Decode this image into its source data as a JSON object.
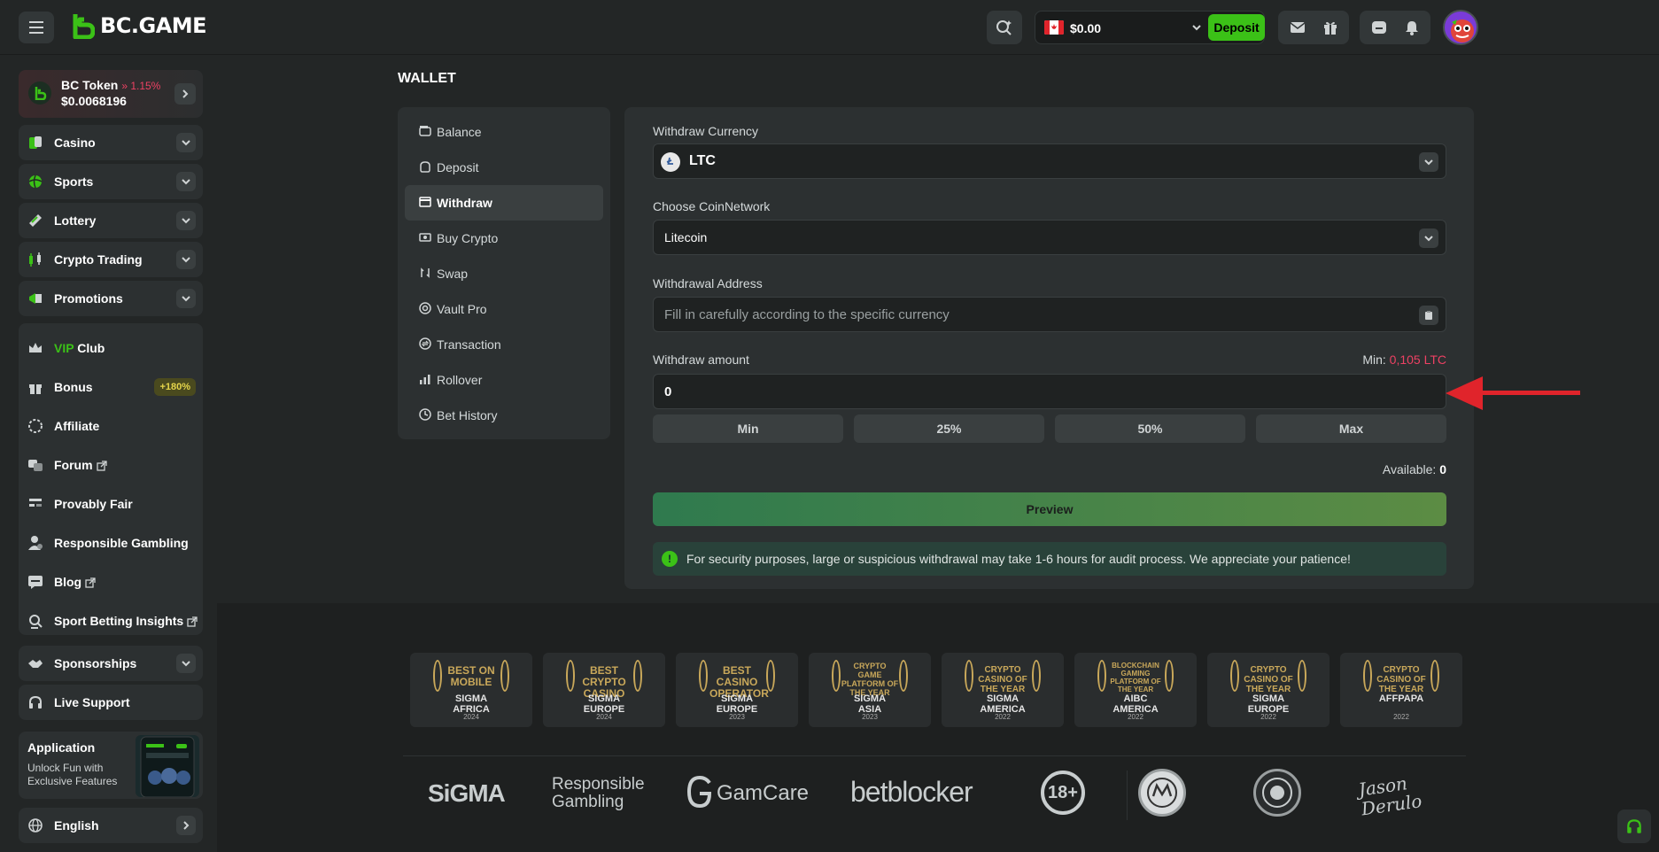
{
  "header": {
    "logo_text": "BC.GAME",
    "balance": "$0.00",
    "deposit_label": "Deposit"
  },
  "sidebar": {
    "token": {
      "name": "BC Token",
      "change": "1.15%",
      "price": "$0.0068196"
    },
    "sections": [
      {
        "label": "Casino",
        "icon": "cards-icon"
      },
      {
        "label": "Sports",
        "icon": "ball-icon"
      },
      {
        "label": "Lottery",
        "icon": "ticket-icon"
      },
      {
        "label": "Crypto Trading",
        "icon": "candles-icon"
      },
      {
        "label": "Promotions",
        "icon": "megaphone-icon"
      }
    ],
    "group_items": {
      "vip_prefix": "VIP",
      "vip_suffix": "Club",
      "bonus": "Bonus",
      "bonus_badge": "+180%",
      "affiliate": "Affiliate",
      "forum": "Forum",
      "provably_fair": "Provably Fair",
      "responsible_gambling": "Responsible Gambling",
      "blog": "Blog",
      "sport_betting_insights": "Sport Betting Insights"
    },
    "sponsorships": "Sponsorships",
    "live_support": "Live Support",
    "application": {
      "title": "Application",
      "subtitle": "Unlock Fun with Exclusive Features"
    },
    "language": "English"
  },
  "wallet": {
    "title": "WALLET",
    "menu": [
      {
        "label": "Balance",
        "icon": "wallet-icon"
      },
      {
        "label": "Deposit",
        "icon": "deposit-icon"
      },
      {
        "label": "Withdraw",
        "icon": "withdraw-icon",
        "active": true
      },
      {
        "label": "Buy Crypto",
        "icon": "card-icon"
      },
      {
        "label": "Swap",
        "icon": "swap-icon"
      },
      {
        "label": "Vault Pro",
        "icon": "vault-icon"
      },
      {
        "label": "Transaction",
        "icon": "transaction-icon"
      },
      {
        "label": "Rollover",
        "icon": "chart-icon"
      },
      {
        "label": "Bet History",
        "icon": "clock-icon"
      }
    ]
  },
  "withdraw": {
    "currency_label": "Withdraw Currency",
    "currency_value": "LTC",
    "network_label": "Choose CoinNetwork",
    "network_value": "Litecoin",
    "address_label": "Withdrawal Address",
    "address_placeholder": "Fill in carefully according to the specific currency",
    "amount_label": "Withdraw amount",
    "min_label": "Min:",
    "min_value": "0,105 LTC",
    "amount_value": "0",
    "buttons": [
      "Min",
      "25%",
      "50%",
      "Max"
    ],
    "available_label": "Available:",
    "available_value": "0",
    "preview_label": "Preview",
    "notice": "For security purposes, large or suspicious withdrawal may take 1-6 hours for audit process. We appreciate your patience!"
  },
  "footer": {
    "awards": [
      {
        "title": "BEST ON MOBILE",
        "org": "SIGMA AFRICA",
        "year": "2024"
      },
      {
        "title": "BEST CRYPTO CASINO",
        "org": "SIGMA EUROPE",
        "year": "2024"
      },
      {
        "title": "BEST CASINO OPERATOR",
        "org": "SIGMA EUROPE",
        "year": "2023"
      },
      {
        "title": "CRYPTO GAME PLATFORM OF THE YEAR",
        "org": "SIGMA ASIA",
        "year": "2023"
      },
      {
        "title": "CRYPTO CASINO OF THE YEAR",
        "org": "SIGMA AMERICA",
        "year": "2022"
      },
      {
        "title": "BLOCKCHAIN GAMING PLATFORM OF THE YEAR",
        "org": "AIBC AMERICA",
        "year": "2022"
      },
      {
        "title": "CRYPTO CASINO OF THE YEAR",
        "org": "SIGMA EUROPE",
        "year": "2022"
      },
      {
        "title": "CRYPTO CASINO OF THE YEAR",
        "org": "AFFPAPA",
        "year": "2022"
      }
    ],
    "partners": {
      "sigma": "SiGMA",
      "responsible_1": "Responsible",
      "responsible_2": "Gambling",
      "gamcare": "GamCare",
      "betblocker": "betblocker",
      "age": "18+",
      "signature": "Jason Derulo"
    }
  },
  "colors": {
    "accent_green": "#3bc117",
    "red": "#ed4163",
    "arrow_red": "#e0242b"
  }
}
